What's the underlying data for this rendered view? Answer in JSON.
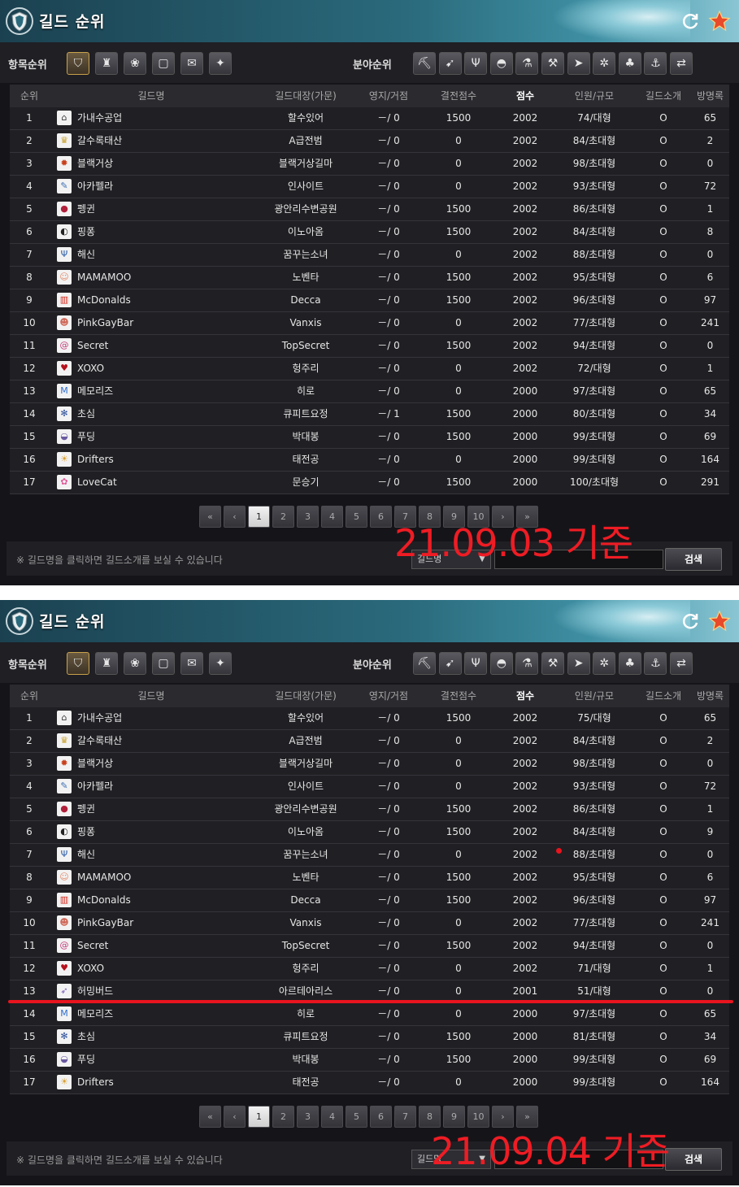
{
  "window_title": "길드 순위",
  "category_label": "항목순위",
  "field_label": "분야순위",
  "columns": [
    "순위",
    "길드명",
    "길드대장(가문)",
    "영지/거점",
    "결전점수",
    "점수",
    "인원/규모",
    "길드소개",
    "방명록"
  ],
  "colors": {
    "accent_red": "#ee1c24",
    "header_teal": "#2a6a7c",
    "panel_bg": "#151519"
  },
  "category_icons": [
    "guild-crest-icon",
    "tower-icon",
    "members-icon",
    "chat-icon",
    "quest-scroll-icon",
    "emblem-icon"
  ],
  "field_icons": [
    "pickaxe-icon",
    "fish-icon",
    "antler-icon",
    "pot-icon",
    "flask-icon",
    "hammer-icon",
    "leaf-arrow-icon",
    "wheel-icon",
    "sprout-icon",
    "anchor-icon",
    "trade-arrows-icon"
  ],
  "pagination": {
    "first": "«",
    "prev": "‹",
    "pages": [
      "1",
      "2",
      "3",
      "4",
      "5",
      "6",
      "7",
      "8",
      "9",
      "10"
    ],
    "next": "›",
    "last": "»",
    "current": "1"
  },
  "footer": {
    "notice": "※ 길드명을 클릭하면 길드소개를 보실 수 있습니다",
    "select_value": "길드명",
    "search_label": "검색"
  },
  "snapshots": [
    {
      "annotation": "21.09.03 기준",
      "rows": [
        {
          "rank": "1",
          "icon": "house-icon",
          "name": "가내수공업",
          "leader": "할수있어",
          "territory": "－/ 0",
          "battle": "1500",
          "score": "2002",
          "members": "74/대형",
          "intro": "O",
          "guestbook": "65"
        },
        {
          "rank": "2",
          "icon": "crown-icon",
          "name": "갈수록태산",
          "leader": "A급전범",
          "territory": "－/ 0",
          "battle": "0",
          "score": "2002",
          "members": "84/초대형",
          "intro": "O",
          "guestbook": "2"
        },
        {
          "rank": "3",
          "icon": "flame-icon",
          "name": "블랙거상",
          "leader": "블랙거상길마",
          "territory": "－/ 0",
          "battle": "0",
          "score": "2002",
          "members": "98/초대형",
          "intro": "O",
          "guestbook": "0"
        },
        {
          "rank": "4",
          "icon": "quill-icon",
          "name": "아카펠라",
          "leader": "인사이트",
          "territory": "－/ 0",
          "battle": "0",
          "score": "2002",
          "members": "93/초대형",
          "intro": "O",
          "guestbook": "72"
        },
        {
          "rank": "5",
          "icon": "penguin-icon",
          "name": "펭귄",
          "leader": "광안리수변공원",
          "territory": "－/ 0",
          "battle": "1500",
          "score": "2002",
          "members": "86/초대형",
          "intro": "O",
          "guestbook": "1"
        },
        {
          "rank": "6",
          "icon": "pingpong-icon",
          "name": "핑퐁",
          "leader": "이노아옴",
          "territory": "－/ 0",
          "battle": "1500",
          "score": "2002",
          "members": "84/초대형",
          "intro": "O",
          "guestbook": "8"
        },
        {
          "rank": "7",
          "icon": "trident-icon",
          "name": "해신",
          "leader": "꿈꾸는소녀",
          "territory": "－/ 0",
          "battle": "0",
          "score": "2002",
          "members": "88/초대형",
          "intro": "O",
          "guestbook": "0"
        },
        {
          "rank": "8",
          "icon": "face-icon",
          "name": "MAMAMOO",
          "leader": "노벤타",
          "territory": "－/ 0",
          "battle": "1500",
          "score": "2002",
          "members": "95/초대형",
          "intro": "O",
          "guestbook": "6"
        },
        {
          "rank": "9",
          "icon": "fries-icon",
          "name": "McDonalds",
          "leader": "Decca",
          "territory": "－/ 0",
          "battle": "1500",
          "score": "2002",
          "members": "96/초대형",
          "intro": "O",
          "guestbook": "97"
        },
        {
          "rank": "10",
          "icon": "clown-icon",
          "name": "PinkGayBar",
          "leader": "Vanxis",
          "territory": "－/ 0",
          "battle": "0",
          "score": "2002",
          "members": "77/초대형",
          "intro": "O",
          "guestbook": "241"
        },
        {
          "rank": "11",
          "icon": "swirl-icon",
          "name": "Secret",
          "leader": "TopSecret",
          "territory": "－/ 0",
          "battle": "1500",
          "score": "2002",
          "members": "94/초대형",
          "intro": "O",
          "guestbook": "0"
        },
        {
          "rank": "12",
          "icon": "lips-icon",
          "name": "XOXO",
          "leader": "헝주리",
          "territory": "－/ 0",
          "battle": "0",
          "score": "2002",
          "members": "72/대형",
          "intro": "O",
          "guestbook": "1"
        },
        {
          "rank": "13",
          "icon": "letter-m-icon",
          "name": "메모리즈",
          "leader": "히로",
          "territory": "－/ 0",
          "battle": "0",
          "score": "2000",
          "members": "97/초대형",
          "intro": "O",
          "guestbook": "65"
        },
        {
          "rank": "14",
          "icon": "snowflake-icon",
          "name": "초심",
          "leader": "큐피트요정",
          "territory": "－/ 1",
          "battle": "1500",
          "score": "2000",
          "members": "80/초대형",
          "intro": "O",
          "guestbook": "34"
        },
        {
          "rank": "15",
          "icon": "pudding-icon",
          "name": "푸딩",
          "leader": "박대봉",
          "territory": "－/ 0",
          "battle": "1500",
          "score": "2000",
          "members": "99/초대형",
          "intro": "O",
          "guestbook": "69"
        },
        {
          "rank": "16",
          "icon": "lion-icon",
          "name": "Drifters",
          "leader": "태전공",
          "territory": "－/ 0",
          "battle": "0",
          "score": "2000",
          "members": "99/초대형",
          "intro": "O",
          "guestbook": "164"
        },
        {
          "rank": "17",
          "icon": "paw-icon",
          "name": "LoveCat",
          "leader": "문승기",
          "territory": "－/ 0",
          "battle": "1500",
          "score": "2000",
          "members": "100/초대형",
          "intro": "O",
          "guestbook": "291"
        }
      ]
    },
    {
      "annotation": "21.09.04 기준",
      "rows": [
        {
          "rank": "1",
          "icon": "house-icon",
          "name": "가내수공업",
          "leader": "할수있어",
          "territory": "－/ 0",
          "battle": "1500",
          "score": "2002",
          "members": "75/대형",
          "intro": "O",
          "guestbook": "65"
        },
        {
          "rank": "2",
          "icon": "crown-icon",
          "name": "갈수록태산",
          "leader": "A급전범",
          "territory": "－/ 0",
          "battle": "0",
          "score": "2002",
          "members": "84/초대형",
          "intro": "O",
          "guestbook": "2"
        },
        {
          "rank": "3",
          "icon": "flame-icon",
          "name": "블랙거상",
          "leader": "블랙거상길마",
          "territory": "－/ 0",
          "battle": "0",
          "score": "2002",
          "members": "98/초대형",
          "intro": "O",
          "guestbook": "0"
        },
        {
          "rank": "4",
          "icon": "quill-icon",
          "name": "아카펠라",
          "leader": "인사이트",
          "territory": "－/ 0",
          "battle": "0",
          "score": "2002",
          "members": "93/초대형",
          "intro": "O",
          "guestbook": "72"
        },
        {
          "rank": "5",
          "icon": "penguin-icon",
          "name": "펭귄",
          "leader": "광안리수변공원",
          "territory": "－/ 0",
          "battle": "1500",
          "score": "2002",
          "members": "86/초대형",
          "intro": "O",
          "guestbook": "1"
        },
        {
          "rank": "6",
          "icon": "pingpong-icon",
          "name": "핑퐁",
          "leader": "이노아옴",
          "territory": "－/ 0",
          "battle": "1500",
          "score": "2002",
          "members": "84/초대형",
          "intro": "O",
          "guestbook": "9"
        },
        {
          "rank": "7",
          "icon": "trident-icon",
          "name": "해신",
          "leader": "꿈꾸는소녀",
          "territory": "－/ 0",
          "battle": "0",
          "score": "2002",
          "members": "88/초대형",
          "intro": "O",
          "guestbook": "0"
        },
        {
          "rank": "8",
          "icon": "face-icon",
          "name": "MAMAMOO",
          "leader": "노벤타",
          "territory": "－/ 0",
          "battle": "1500",
          "score": "2002",
          "members": "95/초대형",
          "intro": "O",
          "guestbook": "6"
        },
        {
          "rank": "9",
          "icon": "fries-icon",
          "name": "McDonalds",
          "leader": "Decca",
          "territory": "－/ 0",
          "battle": "1500",
          "score": "2002",
          "members": "96/초대형",
          "intro": "O",
          "guestbook": "97"
        },
        {
          "rank": "10",
          "icon": "clown-icon",
          "name": "PinkGayBar",
          "leader": "Vanxis",
          "territory": "－/ 0",
          "battle": "0",
          "score": "2002",
          "members": "77/초대형",
          "intro": "O",
          "guestbook": "241"
        },
        {
          "rank": "11",
          "icon": "swirl-icon",
          "name": "Secret",
          "leader": "TopSecret",
          "territory": "－/ 0",
          "battle": "1500",
          "score": "2002",
          "members": "94/초대형",
          "intro": "O",
          "guestbook": "0"
        },
        {
          "rank": "12",
          "icon": "lips-icon",
          "name": "XOXO",
          "leader": "헝주리",
          "territory": "－/ 0",
          "battle": "0",
          "score": "2002",
          "members": "71/대형",
          "intro": "O",
          "guestbook": "1"
        },
        {
          "rank": "13",
          "icon": "hummingbird-icon",
          "name": "허밍버드",
          "leader": "아르테아리스",
          "territory": "－/ 0",
          "battle": "0",
          "score": "2001",
          "members": "51/대형",
          "intro": "O",
          "guestbook": "0"
        },
        {
          "rank": "14",
          "icon": "letter-m-icon",
          "name": "메모리즈",
          "leader": "히로",
          "territory": "－/ 0",
          "battle": "0",
          "score": "2000",
          "members": "97/초대형",
          "intro": "O",
          "guestbook": "65"
        },
        {
          "rank": "15",
          "icon": "snowflake-icon",
          "name": "초심",
          "leader": "큐피트요정",
          "territory": "－/ 0",
          "battle": "1500",
          "score": "2000",
          "members": "81/초대형",
          "intro": "O",
          "guestbook": "34"
        },
        {
          "rank": "16",
          "icon": "pudding-icon",
          "name": "푸딩",
          "leader": "박대봉",
          "territory": "－/ 0",
          "battle": "1500",
          "score": "2000",
          "members": "99/초대형",
          "intro": "O",
          "guestbook": "69"
        },
        {
          "rank": "17",
          "icon": "lion-icon",
          "name": "Drifters",
          "leader": "태전공",
          "territory": "－/ 0",
          "battle": "0",
          "score": "2000",
          "members": "99/초대형",
          "intro": "O",
          "guestbook": "164"
        }
      ]
    }
  ]
}
